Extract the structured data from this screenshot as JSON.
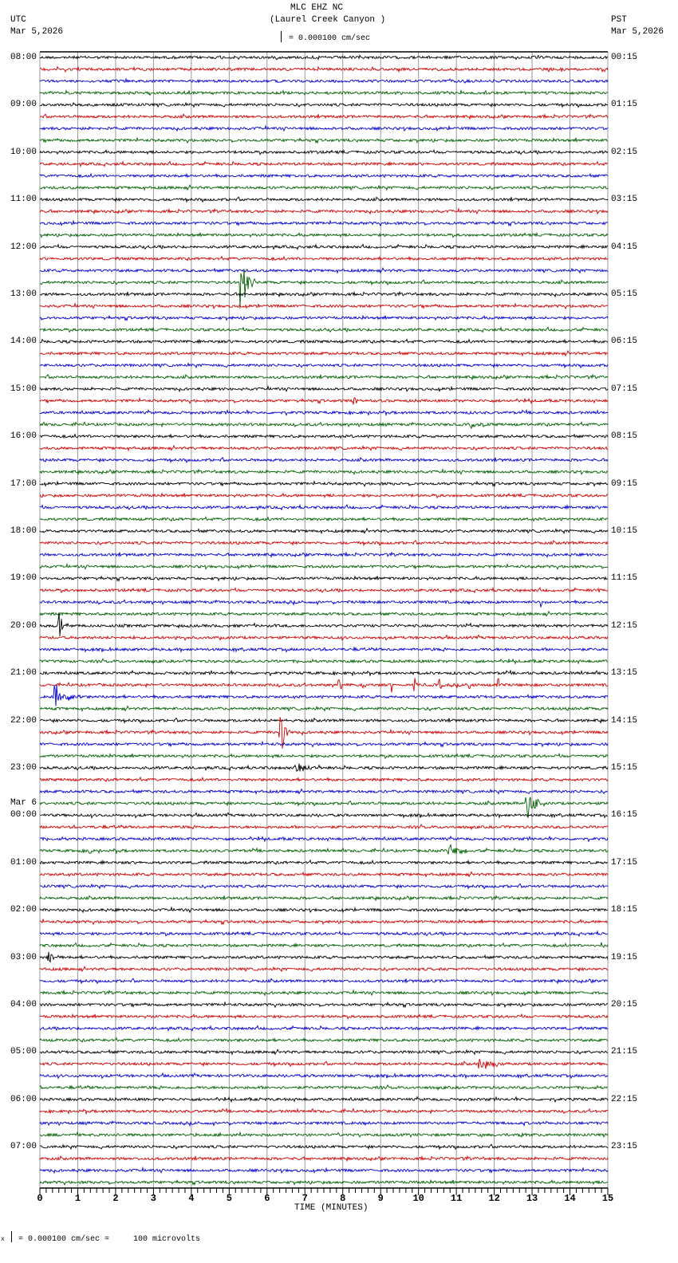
{
  "header": {
    "title": "MLC EHZ NC",
    "subtitle": "(Laurel Creek Canyon )",
    "scale_label": "= 0.000100 cm/sec",
    "left_tz": "UTC",
    "left_date": "Mar 5,2026",
    "right_tz": "PST",
    "right_date": "Mar 5,2026"
  },
  "footer": {
    "scale_note": "= 0.000100 cm/sec =     100 microvolts",
    "scale_prefix": "x"
  },
  "chart_data": {
    "type": "line",
    "title": "MLC EHZ NC (Laurel Creek Canyon )",
    "xlabel": "TIME (MINUTES)",
    "xlim": [
      0,
      15
    ],
    "x_ticks": [
      "0",
      "1",
      "2",
      "3",
      "4",
      "5",
      "6",
      "7",
      "8",
      "9",
      "10",
      "11",
      "12",
      "13",
      "14",
      "15"
    ],
    "trace_count": 96,
    "trace_minutes": 15,
    "trace_colors": [
      "#000000",
      "#d00000",
      "#0000d0",
      "#006000"
    ],
    "grid": "vertical-every-minute",
    "date_change_label": "Mar 6",
    "left_labels": [
      "08:00",
      "09:00",
      "10:00",
      "11:00",
      "12:00",
      "13:00",
      "14:00",
      "15:00",
      "16:00",
      "17:00",
      "18:00",
      "19:00",
      "20:00",
      "21:00",
      "22:00",
      "23:00",
      "00:00",
      "01:00",
      "02:00",
      "03:00",
      "04:00",
      "05:00",
      "06:00",
      "07:00"
    ],
    "right_labels": [
      "00:15",
      "01:15",
      "02:15",
      "03:15",
      "04:15",
      "05:15",
      "06:15",
      "07:15",
      "08:15",
      "09:15",
      "10:15",
      "11:15",
      "12:15",
      "13:15",
      "14:15",
      "15:15",
      "16:15",
      "17:15",
      "18:15",
      "19:15",
      "20:15",
      "21:15",
      "22:15",
      "23:15"
    ],
    "events": [
      {
        "trace": 19,
        "minute": 5.3,
        "amplitude": 45,
        "duration": 0.4
      },
      {
        "trace": 29,
        "minute": 8.3,
        "amplitude": 5,
        "duration": 0.5
      },
      {
        "trace": 31,
        "minute": 11.4,
        "amplitude": 5,
        "duration": 0.4
      },
      {
        "trace": 45,
        "minute": 14.75,
        "amplitude": 4,
        "duration": 0.25
      },
      {
        "trace": 46,
        "minute": 13.2,
        "amplitude": 7,
        "duration": 0.3
      },
      {
        "trace": 48,
        "minute": 0.5,
        "amplitude": 25,
        "duration": 0.2
      },
      {
        "trace": 49,
        "minute": 3.6,
        "amplitude": 4,
        "duration": 0.1
      },
      {
        "trace": 53,
        "minute": 7.9,
        "amplitude": 8,
        "duration": 0.15
      },
      {
        "trace": 53,
        "minute": 8.55,
        "amplitude": 7,
        "duration": 0.15
      },
      {
        "trace": 53,
        "minute": 9.3,
        "amplitude": 8,
        "duration": 0.15
      },
      {
        "trace": 53,
        "minute": 9.9,
        "amplitude": 9,
        "duration": 0.15
      },
      {
        "trace": 53,
        "minute": 10.55,
        "amplitude": 10,
        "duration": 0.15
      },
      {
        "trace": 53,
        "minute": 11.35,
        "amplitude": 7,
        "duration": 0.12
      },
      {
        "trace": 53,
        "minute": 12.1,
        "amplitude": 11,
        "duration": 0.15
      },
      {
        "trace": 54,
        "minute": 0.4,
        "amplitude": 18,
        "duration": 0.8
      },
      {
        "trace": 57,
        "minute": 6.35,
        "amplitude": 40,
        "duration": 0.25
      },
      {
        "trace": 60,
        "minute": 6.8,
        "amplitude": 8,
        "duration": 0.7
      },
      {
        "trace": 63,
        "minute": 12.85,
        "amplitude": 26,
        "duration": 0.5
      },
      {
        "trace": 67,
        "minute": 1.3,
        "amplitude": 5,
        "duration": 0.15
      },
      {
        "trace": 67,
        "minute": 10.8,
        "amplitude": 16,
        "duration": 0.5
      },
      {
        "trace": 75,
        "minute": 14.85,
        "amplitude": 4,
        "duration": 0.15
      },
      {
        "trace": 76,
        "minute": 0.2,
        "amplitude": 12,
        "duration": 0.4
      },
      {
        "trace": 85,
        "minute": 11.6,
        "amplitude": 8,
        "duration": 1.0
      },
      {
        "trace": 91,
        "minute": 12.6,
        "amplitude": 4,
        "duration": 0.4
      }
    ]
  }
}
